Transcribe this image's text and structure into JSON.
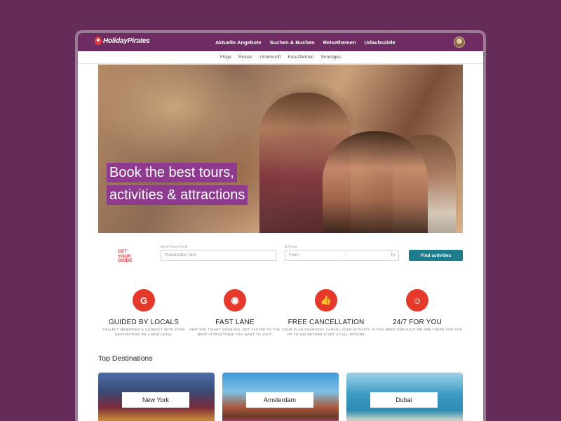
{
  "brand": {
    "name": "HolidayPirates"
  },
  "nav": {
    "main": [
      "Aktuelle Angebote",
      "Suchen & Buchen",
      "Reisethemen",
      "Urlaubsziele"
    ],
    "sub": [
      "Flüge",
      "Reisen",
      "Unterkunft",
      "Kreuzfahrten",
      "Sonstiges"
    ]
  },
  "hero": {
    "line1": "Book the best tours,",
    "line2": "activities & attractions"
  },
  "search": {
    "partner_logo": "GET YOUR GUIDE",
    "destination_label": "DESTINATION",
    "destination_placeholder": "Placeholder Text",
    "dates_label": "DATES",
    "date_from": "From",
    "date_sep": "-",
    "date_to": "To",
    "button": "Find activities"
  },
  "features": [
    {
      "icon": "logo-icon",
      "title": "GUIDED BY LOCALS",
      "desc": "COLLECT MEMORIES & CONNECT WITH YOUR DESTINATION ON A NEW LEVEL"
    },
    {
      "icon": "camera-icon",
      "title": "FAST LANE",
      "desc": "SKIP THE TICKET QUEQUES, GET FASTER TO THE BEST ATTRACTIONS YOU WANT TO VISIT"
    },
    {
      "icon": "thumbs-up-icon",
      "title": "FREE CANCELLATION",
      "desc": "YOUR PLAN CHANGES? CANCEL YOUR ACTIVITY UP TO 24H BEFORE & GET A FULL REFUND"
    },
    {
      "icon": "smiley-icon",
      "title": "24/7 FOR YOU",
      "desc": "IF YOU NEED OUR HELP WE ARE THERE FOR YOU"
    }
  ],
  "destinations": {
    "title": "Top Destinations",
    "items": [
      "New York",
      "Amsterdam",
      "Dubai"
    ]
  },
  "colors": {
    "background": "#652c5a",
    "topbar": "#6e2c63",
    "headline_bg": "#8e3b8f",
    "feature_icon": "#e5392c",
    "button": "#1d7d8c"
  }
}
